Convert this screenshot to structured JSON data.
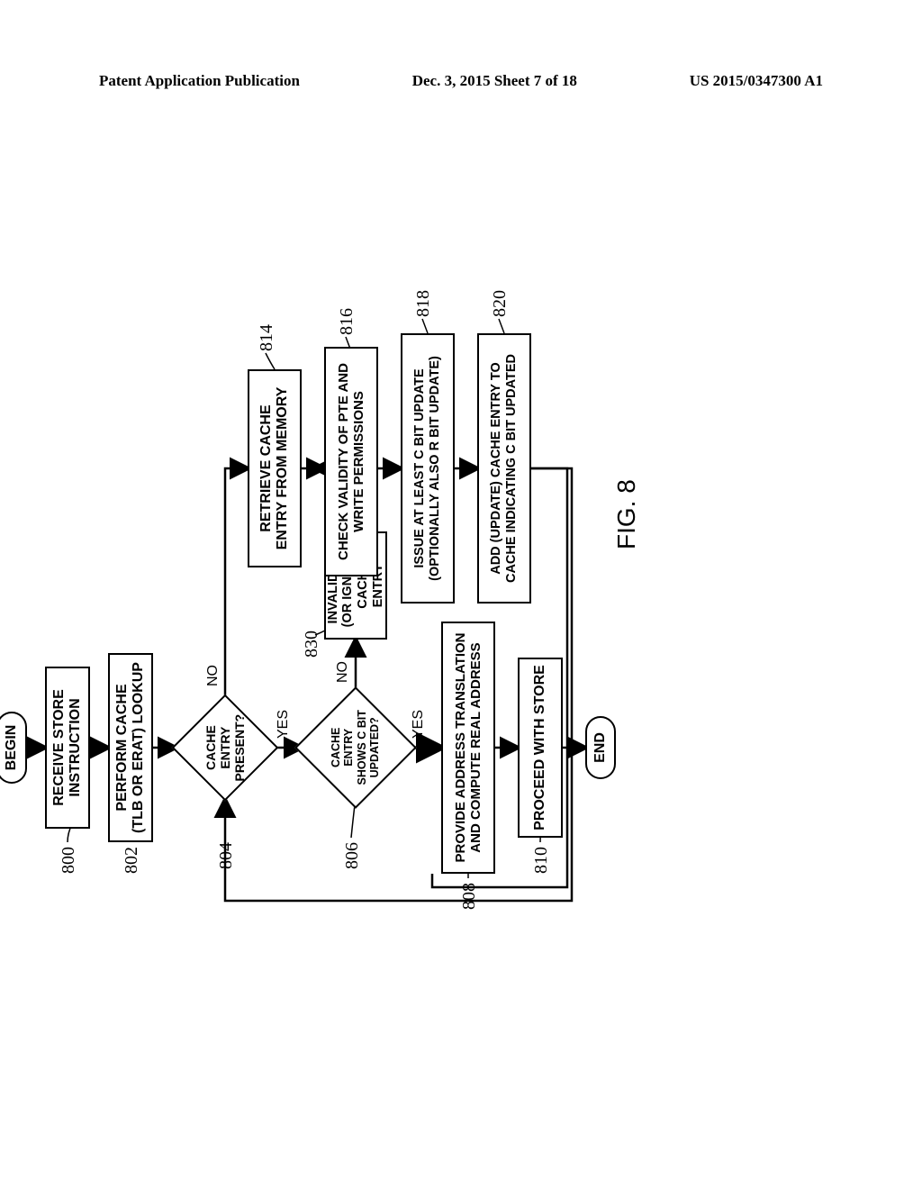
{
  "header": {
    "left": "Patent Application Publication",
    "mid": "Dec. 3, 2015  Sheet 7 of 18",
    "right": "US 2015/0347300 A1"
  },
  "fig": {
    "caption": "FIG. 8",
    "terminals": {
      "begin": "BEGIN",
      "end": "END"
    },
    "nodes": {
      "n800": "RECEIVE STORE\nINSTRUCTION",
      "n802": "PERFORM CACHE\n(TLB OR ERAT) LOOKUP",
      "n804": "CACHE\nENTRY PRESENT?",
      "n806": "CACHE\nENTRY SHOWS C BIT\nUPDATED?",
      "n808": "PROVIDE ADDRESS TRANSLATION\nAND COMPUTE REAL ADDRESS",
      "n810": "PROCEED WITH STORE",
      "n814": "RETRIEVE CACHE\nENTRY FROM MEMORY",
      "n816": "CHECK VALIDITY OF PTE AND\nWRITE PERMISSIONS",
      "n818": "ISSUE AT LEAST C BIT UPDATE\n(OPTIONALLY ALSO R BIT UPDATE)",
      "n820": "ADD (UPDATE) CACHE ENTRY TO\nCACHE INDICATING C BIT UPDATED",
      "n830": "INVALIDATE\n(OR IGNORE)\nCACHE ENTRY"
    },
    "branches": {
      "yes804": "YES",
      "no804": "NO",
      "yes806": "YES",
      "no806": "NO"
    },
    "refs": {
      "r800": "800",
      "r802": "802",
      "r804": "804",
      "r806": "806",
      "r808": "808",
      "r810": "810",
      "r814": "814",
      "r816": "816",
      "r818": "818",
      "r820": "820",
      "r830": "830"
    }
  }
}
